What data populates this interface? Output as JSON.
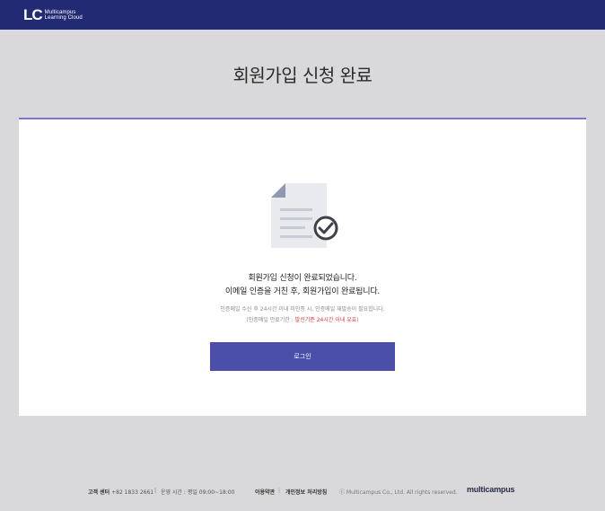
{
  "header": {
    "logo_mark": "LC",
    "logo_line1": "Multicampus",
    "logo_line2": "Learning Cloud"
  },
  "page": {
    "title": "회원가입 신청 완료"
  },
  "card": {
    "icon": "document-check-icon",
    "message_line1": "회원가입 신청이 완료되었습니다.",
    "message_line2": "이메일 인증을 거친 후, 회원가입이 완료됩니다.",
    "note_line1": "인증메일 수신 후 24시간 이내 미인증 시, 인증메일 재발송이 필요합니다.",
    "note_line2_prefix": "(인증메일 만료기한 : ",
    "note_line2_highlight": "발신기준 24시간 이내 유효",
    "note_line2_suffix": ")",
    "login_button": "로그인"
  },
  "footer": {
    "center_label": "고객 센터",
    "center_phone": "+82 1833 2661",
    "separator": "|",
    "hours": "운영 시간 : 평일 09:00~18:00",
    "terms": "이용약관",
    "privacy": "개인정보 처리방침",
    "copyright": "ⓒ Multicampus Co., Ltd. All rights reserved.",
    "brand": "multicampus"
  },
  "colors": {
    "header_bg": "#222a73",
    "page_bg": "#d9d9db",
    "card_accent": "#7d74d6",
    "button_bg": "#4b4fa9",
    "highlight": "#e2343a"
  }
}
